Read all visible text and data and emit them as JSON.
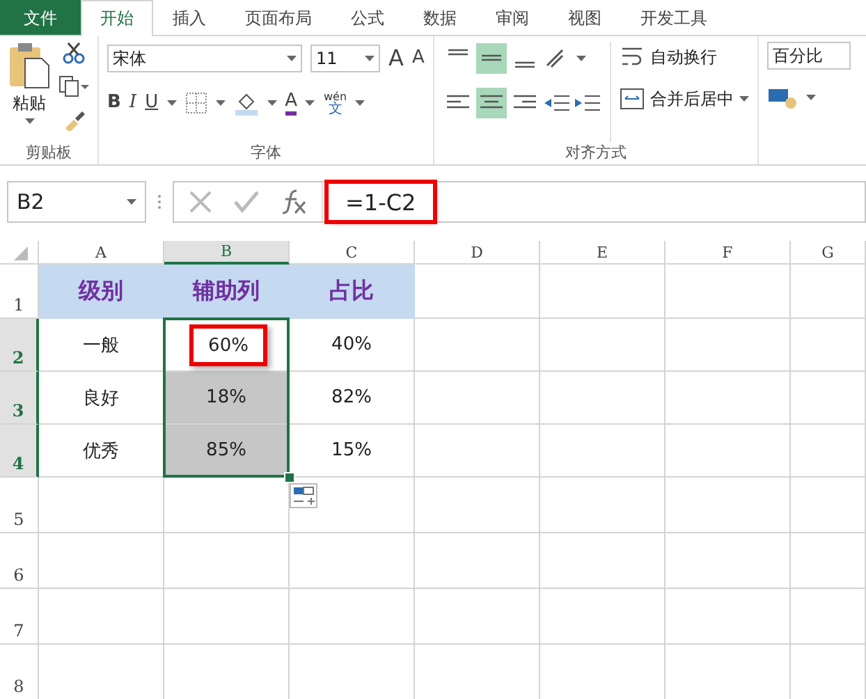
{
  "tabs": [
    {
      "label": "文件",
      "kind": "file",
      "selected": false
    },
    {
      "label": "开始",
      "kind": "tab",
      "selected": true
    },
    {
      "label": "插入",
      "kind": "tab",
      "selected": false
    },
    {
      "label": "页面布局",
      "kind": "tab",
      "selected": false
    },
    {
      "label": "公式",
      "kind": "tab",
      "selected": false
    },
    {
      "label": "数据",
      "kind": "tab",
      "selected": false
    },
    {
      "label": "审阅",
      "kind": "tab",
      "selected": false
    },
    {
      "label": "视图",
      "kind": "tab",
      "selected": false
    },
    {
      "label": "开发工具",
      "kind": "tab",
      "selected": false
    }
  ],
  "ribbon": {
    "clipboard": {
      "paste": "粘贴",
      "label": "剪贴板"
    },
    "font": {
      "name": "宋体",
      "size": "11",
      "grow": "A",
      "shrink": "A",
      "bold": "B",
      "italic": "I",
      "underline": "U",
      "font_color": "A",
      "label": "字体",
      "phonetic_top": "wén",
      "phonetic_bottom": "文"
    },
    "alignment": {
      "vertical": [
        {
          "selected": false
        },
        {
          "selected": true
        },
        {
          "selected": false
        }
      ],
      "horizontal": [
        {
          "selected": false
        },
        {
          "selected": true
        },
        {
          "selected": false
        }
      ],
      "wrap": "自动换行",
      "merge": "合并后居中",
      "label": "对齐方式"
    },
    "number": {
      "format": "百分比"
    }
  },
  "formula_bar": {
    "name_box": "B2",
    "formula": "=1-C2",
    "highlighted": true
  },
  "sheet": {
    "columns": [
      {
        "label": "A",
        "selected": false
      },
      {
        "label": "B",
        "selected": true
      },
      {
        "label": "C",
        "selected": false
      },
      {
        "label": "D",
        "selected": false
      },
      {
        "label": "E",
        "selected": false
      },
      {
        "label": "F",
        "selected": false
      },
      {
        "label": "G",
        "selected": false
      }
    ],
    "rows": [
      {
        "label": "1",
        "selected": false,
        "cells": [
          {
            "text": "级别",
            "kind": "header",
            "selected": false
          },
          {
            "text": "辅助列",
            "kind": "header",
            "selected": false
          },
          {
            "text": "占比",
            "kind": "header",
            "selected": false
          }
        ]
      },
      {
        "label": "2",
        "selected": true,
        "cells": [
          {
            "text": "一般",
            "kind": "data",
            "selected": false
          },
          {
            "text": "60%",
            "kind": "data",
            "selected": true,
            "active": true,
            "highlighted": true
          },
          {
            "text": "40%",
            "kind": "data",
            "selected": false
          }
        ]
      },
      {
        "label": "3",
        "selected": true,
        "cells": [
          {
            "text": "良好",
            "kind": "data",
            "selected": false
          },
          {
            "text": "18%",
            "kind": "data",
            "selected": true
          },
          {
            "text": "82%",
            "kind": "data",
            "selected": false
          }
        ]
      },
      {
        "label": "4",
        "selected": true,
        "cells": [
          {
            "text": "优秀",
            "kind": "data",
            "selected": false
          },
          {
            "text": "85%",
            "kind": "data",
            "selected": true
          },
          {
            "text": "15%",
            "kind": "data",
            "selected": false
          }
        ]
      },
      {
        "label": "5",
        "selected": false,
        "cells": []
      },
      {
        "label": "6",
        "selected": false,
        "cells": []
      },
      {
        "label": "7",
        "selected": false,
        "cells": []
      },
      {
        "label": "8",
        "selected": false,
        "cells": []
      }
    ]
  }
}
